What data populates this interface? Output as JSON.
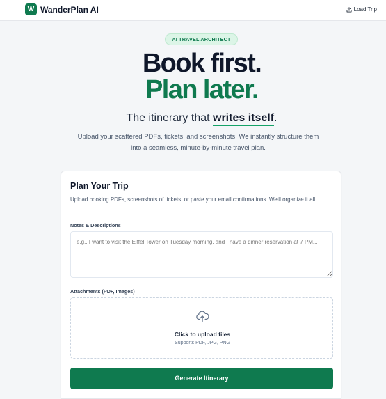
{
  "header": {
    "logo_letter": "W",
    "brand_name": "WanderPlan AI",
    "load_trip_label": "Load Trip",
    "load_trip_icon": "upload-icon"
  },
  "hero": {
    "badge": "AI TRAVEL ARCHITECT",
    "headline_line1": "Book first.",
    "headline_line2": "Plan later.",
    "tagline_prefix": "The itinerary that ",
    "tagline_emphasis": "writes itself",
    "tagline_suffix": ".",
    "subtitle": "Upload your scattered PDFs, tickets, and screenshots. We instantly structure them into a seamless, minute-by-minute travel plan."
  },
  "card": {
    "title": "Plan Your Trip",
    "description": "Upload booking PDFs, screenshots of tickets, or paste your email confirmations. We'll organize it all.",
    "notes_label": "Notes & Descriptions",
    "notes_placeholder": "e.g., I want to visit the Eiffel Tower on Tuesday morning, and I have a dinner reservation at 7 PM...",
    "notes_value": "",
    "attachments_label": "Attachments (PDF, Images)",
    "upload_title": "Click to upload files",
    "upload_subtitle": "Supports PDF, JPG, PNG",
    "upload_icon": "cloud-upload-icon",
    "generate_label": "Generate Itinerary"
  },
  "colors": {
    "brand_green": "#0f7a4f",
    "accent_green": "#16a368",
    "badge_bg": "#dcf5e7",
    "background": "#f4f6f8"
  }
}
